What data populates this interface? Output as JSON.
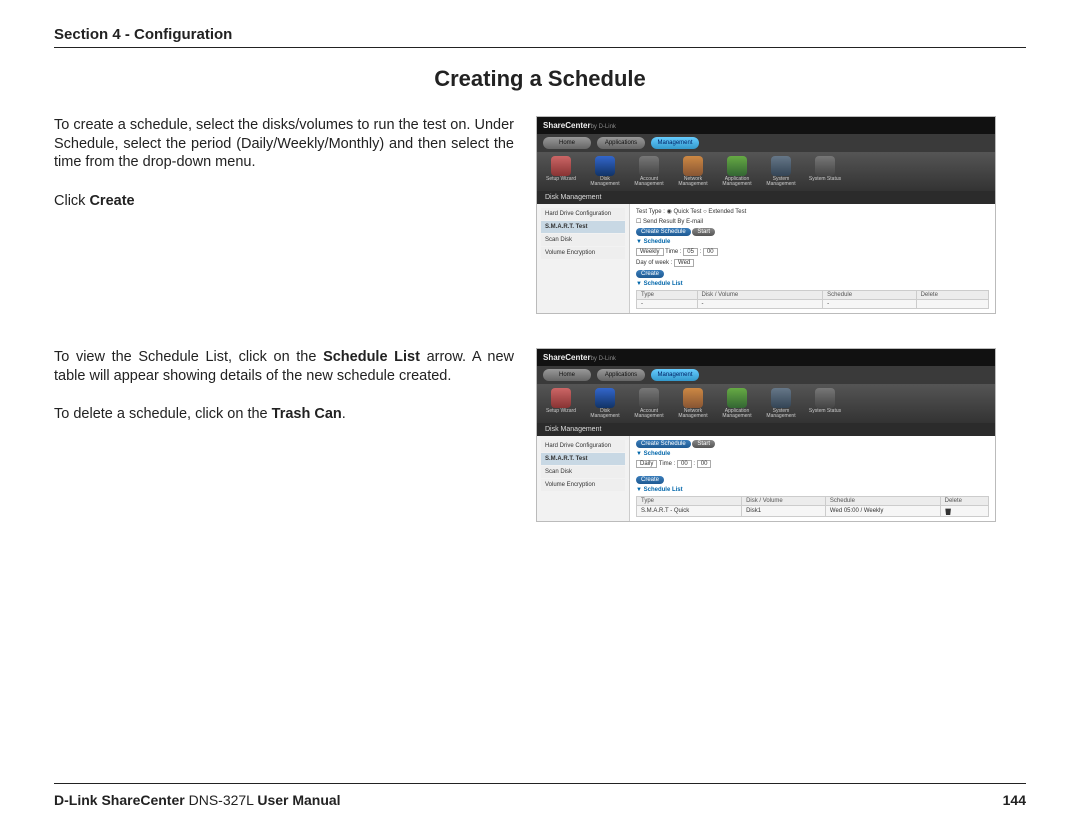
{
  "header": {
    "section": "Section 4 - Configuration"
  },
  "title": "Creating a Schedule",
  "block1": {
    "para1": "To create a schedule, select the disks/volumes to run the test on. Under Schedule, select the period (Daily/Weekly/Monthly) and then select the time from the drop-down menu.",
    "click_prefix": "Click ",
    "click_bold": "Create"
  },
  "block2": {
    "p1_a": "To view the Schedule List, click on the ",
    "p1_b": "Schedule List",
    "p1_c": " arrow. A new table will appear showing details of the new schedule created.",
    "p2_a": "To delete a schedule, click on the ",
    "p2_b": "Trash Can",
    "p2_c": "."
  },
  "shot": {
    "brand": "ShareCenter",
    "brand_sub": "by D-Link",
    "nav": {
      "home": "Home",
      "apps": "Applications",
      "mgmt": "Management"
    },
    "icons": {
      "wizard": "Setup Wizard",
      "disk": "Disk Management",
      "acct": "Account Management",
      "net": "Network Management",
      "app": "Application Management",
      "sys": "System Management",
      "status": "System Status"
    },
    "bar": "Disk Management",
    "side": {
      "hdd": "Hard Drive Configuration",
      "smart": "S.M.A.R.T. Test",
      "scan": "Scan Disk",
      "venc": "Volume Encryption"
    },
    "main": {
      "test_type_label": "Test Type :",
      "quick": "Quick Test",
      "extended": "Extended Test",
      "send_email": "Send Result By E-mail",
      "create_sched": "Create Schedule",
      "start": "Start",
      "schedule_hdr": "Schedule",
      "period_weekly": "Weekly",
      "period_daily": "Daily",
      "time_lbl": "Time :",
      "time_h": "05",
      "time_m": "00",
      "dow_lbl": "Day of week :",
      "dow_val": "Wed",
      "create": "Create",
      "sched_list_hdr": "Schedule List",
      "th_type": "Type",
      "th_disk": "Disk / Volume",
      "th_sched": "Schedule",
      "th_del": "Delete",
      "row2_type": "S.M.A.R.T - Quick",
      "row2_disk": "Disk1",
      "row2_sched": "Wed 05:00 / Weekly",
      "time2_h": "00",
      "time2_m": "00"
    }
  },
  "footer": {
    "left_bold1": "D-Link ShareCenter",
    "left_plain": " DNS-327L ",
    "left_bold2": "User Manual",
    "page": "144"
  }
}
